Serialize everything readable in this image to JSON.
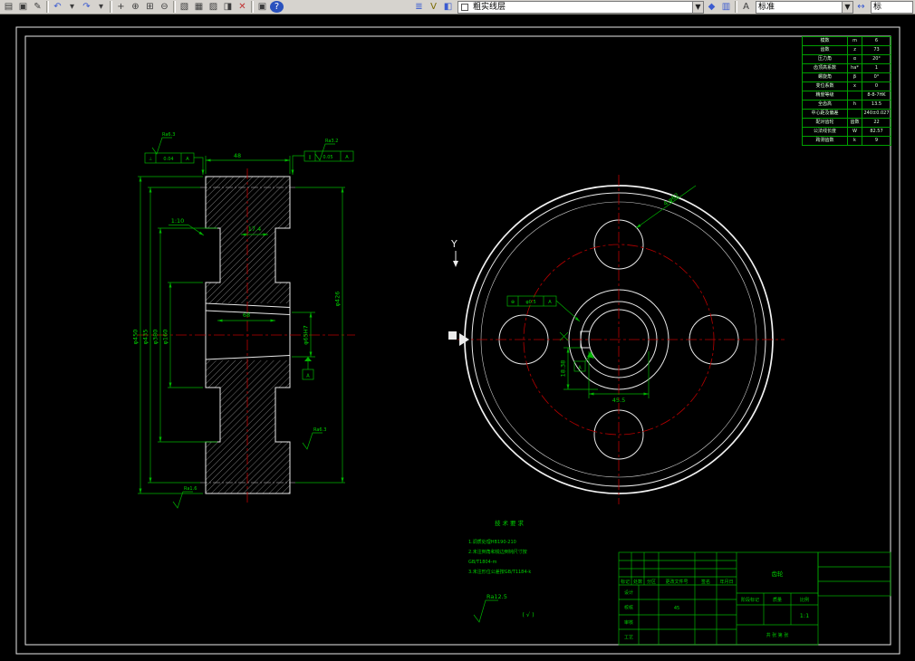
{
  "colors": {
    "dimension_green": "#00b400",
    "centerline_red": "#b80000",
    "drawing_white": "#ececec",
    "toolbar_bg": "#d6d3ce",
    "canvas_bg": "#000000"
  },
  "toolbar": {
    "icons_file": [
      {
        "name": "new-drawing-icon",
        "glyph": "▤"
      },
      {
        "name": "open-drawing-icon",
        "glyph": "▣"
      },
      {
        "name": "edit-sketch-icon",
        "glyph": "✎"
      }
    ],
    "icons_undo": [
      {
        "name": "undo-icon",
        "glyph": "↶",
        "color": "#3b5bd0"
      },
      {
        "name": "undo-dropdown-icon",
        "glyph": "▾"
      },
      {
        "name": "redo-icon",
        "glyph": "↷",
        "color": "#3b5bd0"
      },
      {
        "name": "redo-dropdown-icon",
        "glyph": "▾"
      }
    ],
    "icons_zoom": [
      {
        "name": "pan-icon",
        "glyph": "+"
      },
      {
        "name": "zoom-realtime-icon",
        "glyph": "⊕"
      },
      {
        "name": "zoom-window-icon",
        "glyph": "⊞"
      },
      {
        "name": "zoom-previous-icon",
        "glyph": "⊖"
      }
    ],
    "icons_insert": [
      {
        "name": "named-views-icon",
        "glyph": "▧"
      },
      {
        "name": "table-icon",
        "glyph": "▦"
      },
      {
        "name": "hatch-icon",
        "glyph": "▨"
      },
      {
        "name": "block-editor-icon",
        "glyph": "◨"
      },
      {
        "name": "close-block-icon",
        "glyph": "✕",
        "color": "#c03030"
      }
    ],
    "icons_tools": [
      {
        "name": "calculator-icon",
        "glyph": "▣"
      },
      {
        "name": "help-icon",
        "glyph": "?",
        "color": "#ffffff",
        "bg": "#2a52be"
      }
    ],
    "icons_layer_tools": [
      {
        "name": "layer-properties-icon",
        "glyph": "≣",
        "color": "#3b5bd0"
      },
      {
        "name": "layer-filter-icon",
        "glyph": "V",
        "color": "#7a6a00"
      },
      {
        "name": "layer-walk-icon",
        "glyph": "◧",
        "color": "#3b5bd0"
      }
    ],
    "layer_combo_value": "粗实线层",
    "icons_after_layer": [
      {
        "name": "make-current-layer-icon",
        "glyph": "◆",
        "color": "#3b5bd0"
      },
      {
        "name": "layer-states-icon",
        "glyph": "▥",
        "color": "#3b5bd0"
      }
    ],
    "icons_text": [
      {
        "name": "text-style-icon",
        "glyph": "A"
      }
    ],
    "style_combo_value": "标准",
    "icons_dim": [
      {
        "name": "dim-style-icon",
        "glyph": "↔",
        "color": "#3b5bd0"
      }
    ],
    "right_combo_value": "标"
  },
  "section_view": {
    "od_dim": "φ450",
    "pitch_dim": "φ435",
    "web_dim": "φ380",
    "hub_dim": "φ160",
    "right_dim": "φ426",
    "bore_dim": "φ65H7",
    "width_dim": "48",
    "keyway_offset_dim": "17.4",
    "keyway_len_dim": "68",
    "taper_label": "1:10",
    "tol_left": {
      "sym": "⊥",
      "val": "0.04",
      "ref": "A"
    },
    "tol_right": {
      "sym": "∥",
      "val": "0.05",
      "ref": "A"
    },
    "ra_top_left": "Ra6.3",
    "ra_top_right": "Ra3.2",
    "ra_bottom_left": "Ra1.6",
    "ra_bottom_right": "Ra6.3",
    "datum": "A"
  },
  "front_view": {
    "holes_dim": "4-φ62",
    "keyway_depth_dim": "18.38",
    "bore_width_dim": "45.5",
    "pos_tol": {
      "sym": "⊕",
      "val": "φ0.5",
      "ref": "A"
    },
    "section_label": "Y",
    "datum": "A"
  },
  "tech_requirements": {
    "title": "技术要求",
    "lines": [
      "1.调质处理HB190-210",
      "2.未注倒角和锐边倒钝尺寸按",
      "GB/T1804-m",
      "3.未注形位公差按GB/T1184-k"
    ]
  },
  "surface_note": {
    "symbol_text": "Ra12.5",
    "rest": "( √ )"
  },
  "param_table": {
    "rows": [
      [
        "模数",
        "m",
        "6"
      ],
      [
        "齿数",
        "z",
        "73"
      ],
      [
        "压力角",
        "α",
        "20°"
      ],
      [
        "齿顶高系数",
        "ha*",
        "1"
      ],
      [
        "螺旋角",
        "β",
        "0°"
      ],
      [
        "变位系数",
        "x",
        "0"
      ],
      [
        "精度等级",
        "",
        "8-8-7HK"
      ],
      [
        "全齿高",
        "h",
        "13.5"
      ],
      [
        "中心距及偏差",
        "",
        "240±0.027"
      ],
      [
        "配对齿轮",
        "齿数",
        "22"
      ],
      [
        "公法线长度",
        "W",
        "82.57"
      ],
      [
        "跨测齿数",
        "k",
        "9"
      ]
    ]
  },
  "title_block": {
    "rev_headers": [
      "标记",
      "处数",
      "分区",
      "更改文件号",
      "签名",
      "年月日"
    ],
    "sign_rows": [
      "设计",
      "校核",
      "审核",
      "工艺"
    ],
    "stage_labels": [
      "阶段标记",
      "质量",
      "比例"
    ],
    "scale": "1:1",
    "sheet": "共 张 第 张",
    "part_name": "齿轮",
    "material": "45"
  }
}
